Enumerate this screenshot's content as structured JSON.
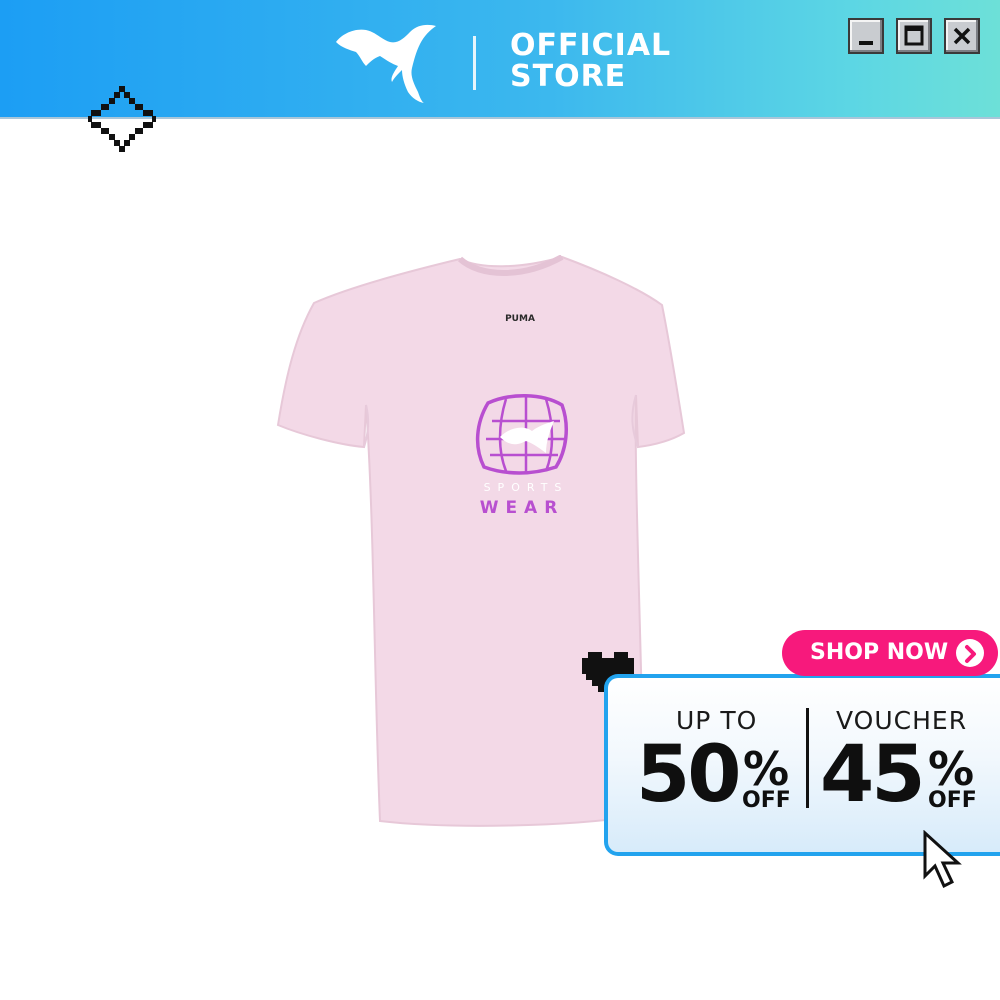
{
  "header": {
    "brand_icon": "puma-cat-logo-icon",
    "store_line1": "OFFICIAL",
    "store_line2": "STORE",
    "window_buttons": [
      "minimize-icon",
      "maximize-icon",
      "close-icon"
    ]
  },
  "product": {
    "image": "pink-tshirt-image",
    "graphic_text_top": "SPORTS",
    "graphic_text_bottom": "WEAR",
    "neck_label": "PUMA"
  },
  "promo": {
    "cta_label": "SHOP NOW",
    "left": {
      "label": "UP TO",
      "number": "50",
      "percent": "%",
      "suffix": "OFF"
    },
    "right": {
      "label": "VOUCHER",
      "number": "45",
      "percent": "%",
      "suffix": "OFF"
    }
  },
  "colors": {
    "header_start": "#1c9ef4",
    "header_end": "#6de0d8",
    "shirt": "#f2d8e6",
    "graphic": "#b84fd0",
    "cta": "#f7197c",
    "promo_border": "#22a3ee"
  }
}
